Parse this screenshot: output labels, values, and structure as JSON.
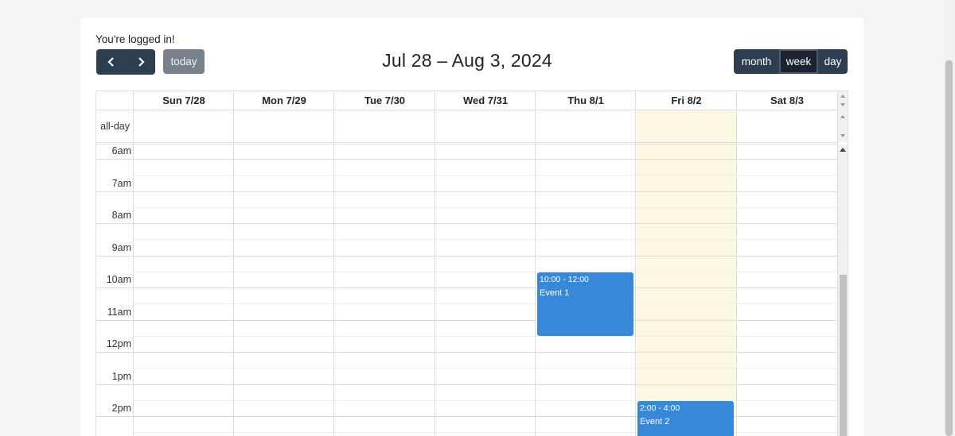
{
  "status_text": "You're logged in!",
  "toolbar": {
    "prev_icon": "chevron-left-icon",
    "next_icon": "chevron-right-icon",
    "today_label": "today",
    "title": "Jul 28 – Aug 3, 2024",
    "views": [
      "month",
      "week",
      "day"
    ],
    "active_view": "week"
  },
  "calendar": {
    "allday_label": "all-day",
    "days": [
      "Sun 7/28",
      "Mon 7/29",
      "Tue 7/30",
      "Wed 7/31",
      "Thu 8/1",
      "Fri 8/2",
      "Sat 8/3"
    ],
    "today_index": 5,
    "times": [
      "6am",
      "7am",
      "8am",
      "9am",
      "10am",
      "11am",
      "12pm",
      "1pm",
      "2pm"
    ],
    "events": [
      {
        "time": "10:00 - 12:00",
        "title": "Event 1",
        "day": "Thu 8/1"
      },
      {
        "time": "2:00 - 4:00",
        "title": "Event 2",
        "day": "Fri 8/2"
      }
    ]
  },
  "colors": {
    "primary": "#2c3e50",
    "event": "#3788d8",
    "today_bg": "#fcf8e3",
    "today_button": "#77818c"
  }
}
